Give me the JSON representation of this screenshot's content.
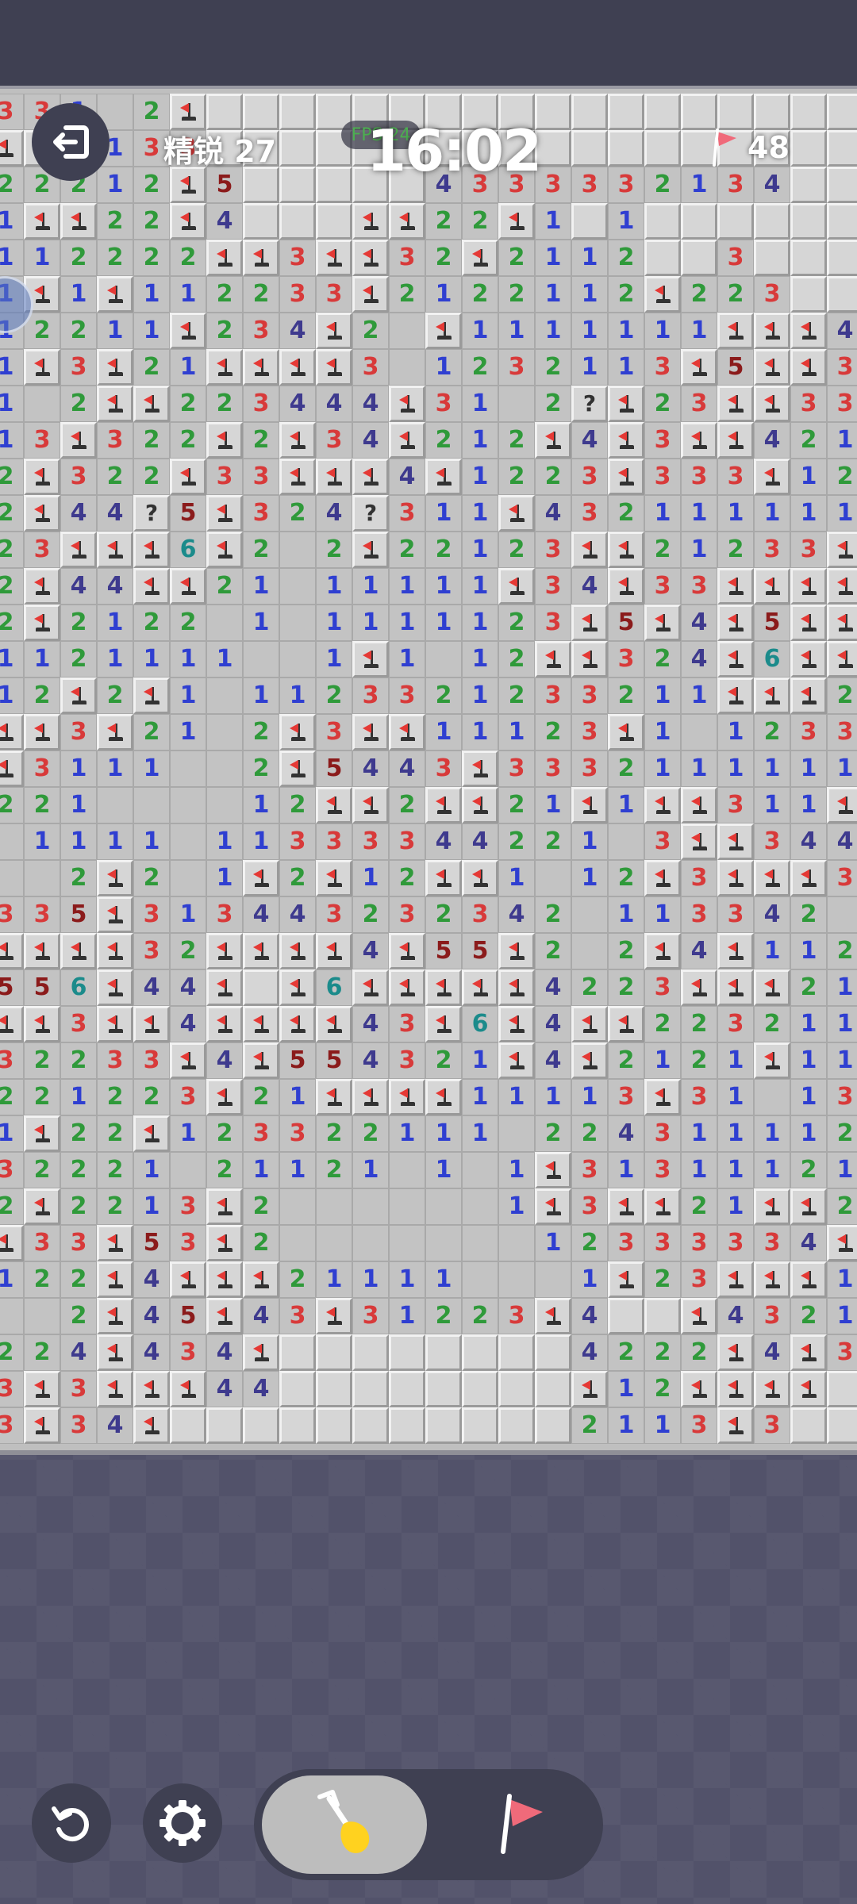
{
  "header": {
    "difficulty_label": "精锐 27",
    "fps_label": "FPS 24",
    "timer": "16:02",
    "flags_remaining": "48"
  },
  "icons": {
    "exit": "exit-icon",
    "flag_counter": "flag-icon",
    "restart": "restart-icon",
    "settings": "gear-icon",
    "dig_mode": "shovel-icon",
    "flag_mode": "flag-icon"
  },
  "colors": {
    "accent_flag": "#e53935",
    "panel": "#3f4052",
    "n1": "#2f3fd1",
    "n2": "#2f9a3a",
    "n3": "#d83a3a",
    "n4": "#3e3a8e",
    "n5": "#8b1b1b",
    "n6": "#1b8b8b"
  },
  "board": {
    "legend": "digits 1-6 = number, F = flag, ? = question, # = unopened, . = opened blank",
    "rows": [
      "331.2F##################",
      "FF1133##################",
      "22212F5#####4333332134##",
      "1FF22F4###FF22F1#1######",
      "112222FF3FF32F2112##3###",
      "1F1F112233F2122112F223##",
      "12211F234F2.F1111111FFF4",
      "1F3F21FFFF3.1232113F5FF3",
      "1.2FF223444F31.2?F23FF33",
      "13F322F2F34F212F4F3FF421",
      "2F322F33FFF4F1223F333F12",
      "2F44?5F324?311F432111111",
      "23FFF6F2.2F22123FF21233F",
      "2F44FF21.11111F34F33FFFF",
      "2F2122.1.1111123F5F4F5FF",
      "1121111..1F1.12FF324F6FF",
      "12F2F1.1123321233211FFF2",
      "FF3F21.2F3FF11123F1.1233",
      "F3111..2F5443F3332111111",
      "221....12FF2FF21F1FF311F",
      ".1111.11333344221.3FF3442",
      "..2F2.1F2F12FF1.12F3FFF3",
      "335F313443232342.113342..",
      "FFFF32FFFF4F55F2.2F4F112",
      "556F44F#F6FFFFF4223FFF21",
      "FF3FF4FFFF43F6F4FF2232113",
      "32233F4F554321F4F2121F111",
      "221223F21FFFF11113F31.133",
      "1F22F123322111.2243111122",
      "32221.21121.1.1F313111211",
      "2F2213F2......1F3FF21FF2F",
      "F33F53F2.......12333334F",
      "122F4FFF21111...1F23FFF11",
      "..2F45F43F31223F4##F4321",
      "224F434F########4222F4F3",
      "3F3FFF44########F12FFFF",
      "3F34F###########2113F3#"
    ]
  }
}
